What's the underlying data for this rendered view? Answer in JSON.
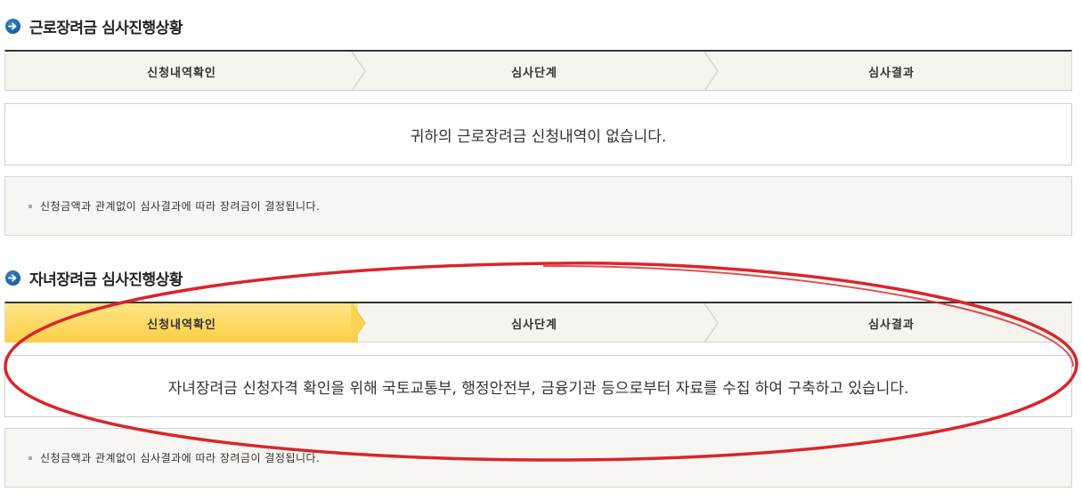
{
  "section1": {
    "title": "근로장려금 심사진행상황",
    "steps": [
      "신청내역확인",
      "심사단계",
      "심사결과"
    ],
    "active_step": null,
    "message": "귀하의 근로장려금 신청내역이 없습니다.",
    "note": "신청금액과 관계없이 심사결과에 따라 장려금이 결정됩니다."
  },
  "section2": {
    "title": "자녀장려금 심사진행상황",
    "steps": [
      "신청내역확인",
      "심사단계",
      "심사결과"
    ],
    "active_step": 0,
    "message": "자녀장려금 신청자격 확인을 위해 국토교통부, 행정안전부, 금융기관 등으로부터 자료를 수집 하여 구축하고 있습니다.",
    "note": "신청금액과 관계없이 심사결과에 따라 장려금이 결정됩니다."
  },
  "colors": {
    "active_step": "#fbcf45",
    "title_bullet": "#1b5ea0",
    "annotation": "#d9262b"
  },
  "icons": [
    "arrow-right-circle-icon"
  ]
}
